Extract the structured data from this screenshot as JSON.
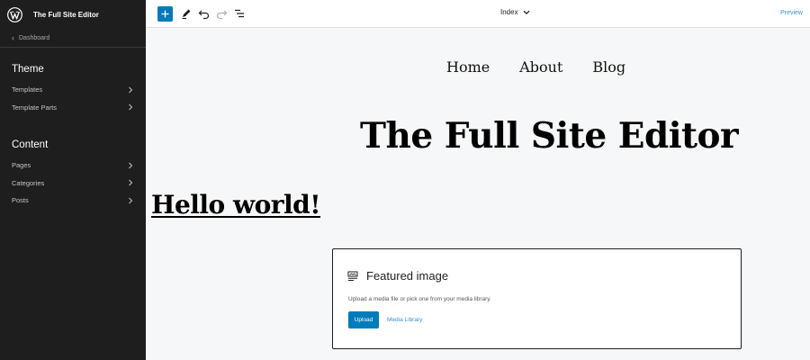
{
  "sidebar": {
    "site_title": "The Full Site Editor",
    "back_label": "Dashboard",
    "theme_section": {
      "title": "Theme",
      "items": [
        {
          "label": "Templates"
        },
        {
          "label": "Template Parts"
        }
      ]
    },
    "content_section": {
      "title": "Content",
      "items": [
        {
          "label": "Pages"
        },
        {
          "label": "Categories"
        },
        {
          "label": "Posts"
        }
      ]
    },
    "icons": {
      "logo": "wordpress-logo-icon",
      "back": "chevron-left-icon",
      "item": "chevron-right-icon"
    }
  },
  "toolbar": {
    "document_title": "Index",
    "preview_label": "Preview",
    "icons": [
      "plus-icon",
      "pencil-icon",
      "undo-icon",
      "redo-icon",
      "list-view-icon",
      "chevron-down-icon"
    ]
  },
  "canvas": {
    "nav": [
      "Home",
      "About",
      "Blog"
    ],
    "site_title": "The Full Site Editor",
    "post_title": "Hello world!",
    "featured_image": {
      "title": "Featured image",
      "instructions": "Upload a media file or pick one from your media library.",
      "upload_label": "Upload",
      "media_library_label": "Media Library"
    }
  },
  "colors": {
    "sidebar_bg": "#1e1e1e",
    "accent": "#007cba",
    "link": "#3d8fc9",
    "canvas_bg": "#f6f7f8"
  }
}
